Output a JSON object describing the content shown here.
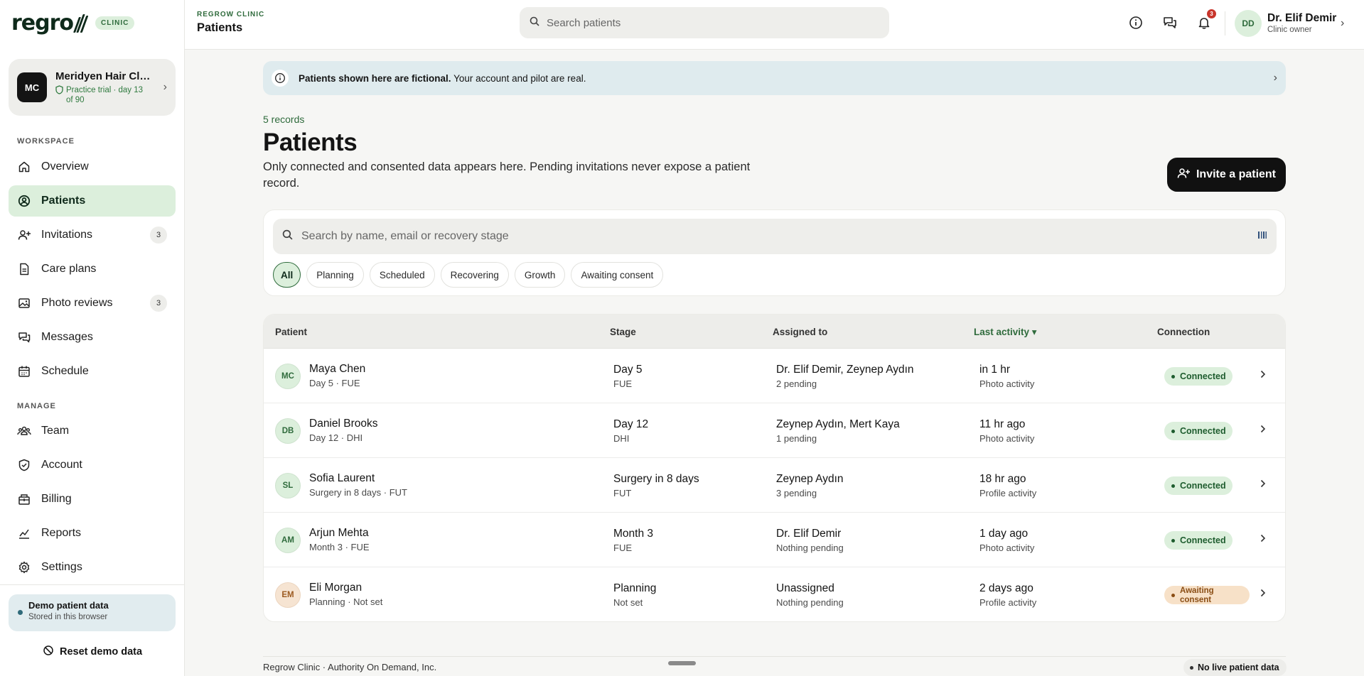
{
  "brand": {
    "logo": "regro",
    "pill": "CLINIC"
  },
  "practice": {
    "initials": "MC",
    "name": "Meridyen Hair Cli...",
    "trial": "Practice trial · day 13 of 90"
  },
  "sidebar": {
    "workspace_label": "WORKSPACE",
    "manage_label": "MANAGE",
    "workspace": [
      {
        "label": "Overview",
        "icon": "home-icon"
      },
      {
        "label": "Patients",
        "icon": "patient-icon",
        "active": true
      },
      {
        "label": "Invitations",
        "icon": "user-plus-icon",
        "badge": "3"
      },
      {
        "label": "Care plans",
        "icon": "document-icon"
      },
      {
        "label": "Photo reviews",
        "icon": "photo-icon",
        "badge": "3"
      },
      {
        "label": "Messages",
        "icon": "chat-icon"
      },
      {
        "label": "Schedule",
        "icon": "calendar-icon"
      }
    ],
    "manage": [
      {
        "label": "Team",
        "icon": "team-icon"
      },
      {
        "label": "Account",
        "icon": "shield-icon"
      },
      {
        "label": "Billing",
        "icon": "billing-icon"
      },
      {
        "label": "Reports",
        "icon": "chart-icon"
      },
      {
        "label": "Settings",
        "icon": "gear-icon"
      }
    ],
    "demo": {
      "title": "Demo patient data",
      "subtitle": "Stored in this browser"
    },
    "reset_label": "Reset demo data"
  },
  "header": {
    "crumb_top": "REGROW CLINIC",
    "crumb_title": "Patients",
    "search_placeholder": "Search patients",
    "notifications_count": "3",
    "user": {
      "initials": "DD",
      "name": "Dr. Elif Demir",
      "role": "Clinic owner"
    }
  },
  "banner": {
    "bold": "Patients shown here are fictional.",
    "text": " Your account and pilot are real."
  },
  "main": {
    "records": "5 records",
    "title": "Patients",
    "description": "Only connected and consented data appears here. Pending invitations never expose a patient record.",
    "invite_label": "Invite a patient",
    "search_placeholder": "Search by name, email or recovery stage",
    "filters": [
      "All",
      "Planning",
      "Scheduled",
      "Recovering",
      "Growth",
      "Awaiting consent"
    ]
  },
  "table": {
    "headers": {
      "patient": "Patient",
      "stage": "Stage",
      "assigned": "Assigned to",
      "activity": "Last activity ▾",
      "connection": "Connection"
    },
    "rows": [
      {
        "initials": "MC",
        "name": "Maya Chen",
        "sub": "Day 5 · FUE",
        "stage": "Day 5",
        "stage_sub": "FUE",
        "assigned": "Dr. Elif Demir, Zeynep Aydın",
        "assigned_sub": "2 pending",
        "activity": "in 1 hr",
        "activity_sub": "Photo activity",
        "status": "Connected",
        "status_type": "connected",
        "avatar": "green"
      },
      {
        "initials": "DB",
        "name": "Daniel Brooks",
        "sub": "Day 12 · DHI",
        "stage": "Day 12",
        "stage_sub": "DHI",
        "assigned": "Zeynep Aydın, Mert Kaya",
        "assigned_sub": "1 pending",
        "activity": "11 hr ago",
        "activity_sub": "Photo activity",
        "status": "Connected",
        "status_type": "connected",
        "avatar": "green"
      },
      {
        "initials": "SL",
        "name": "Sofia Laurent",
        "sub": "Surgery in 8 days · FUT",
        "stage": "Surgery in 8 days",
        "stage_sub": "FUT",
        "assigned": "Zeynep Aydın",
        "assigned_sub": "3 pending",
        "activity": "18 hr ago",
        "activity_sub": "Profile activity",
        "status": "Connected",
        "status_type": "connected",
        "avatar": "green"
      },
      {
        "initials": "AM",
        "name": "Arjun Mehta",
        "sub": "Month 3 · FUE",
        "stage": "Month 3",
        "stage_sub": "FUE",
        "assigned": "Dr. Elif Demir",
        "assigned_sub": "Nothing pending",
        "activity": "1 day ago",
        "activity_sub": "Photo activity",
        "status": "Connected",
        "status_type": "connected",
        "avatar": "green"
      },
      {
        "initials": "EM",
        "name": "Eli Morgan",
        "sub": "Planning · Not set",
        "stage": "Planning",
        "stage_sub": "Not set",
        "assigned": "Unassigned",
        "assigned_sub": "Nothing pending",
        "activity": "2 days ago",
        "activity_sub": "Profile activity",
        "status": "Awaiting consent",
        "status_type": "awaiting",
        "avatar": "orange"
      }
    ]
  },
  "footer": {
    "text": "Regrow Clinic · Authority On Demand, Inc.",
    "badge": "No live patient data"
  },
  "colors": {
    "accent": "#2f6b3c",
    "accent_bg": "#dcefdc",
    "awaiting_bg": "#f7e1c8"
  }
}
